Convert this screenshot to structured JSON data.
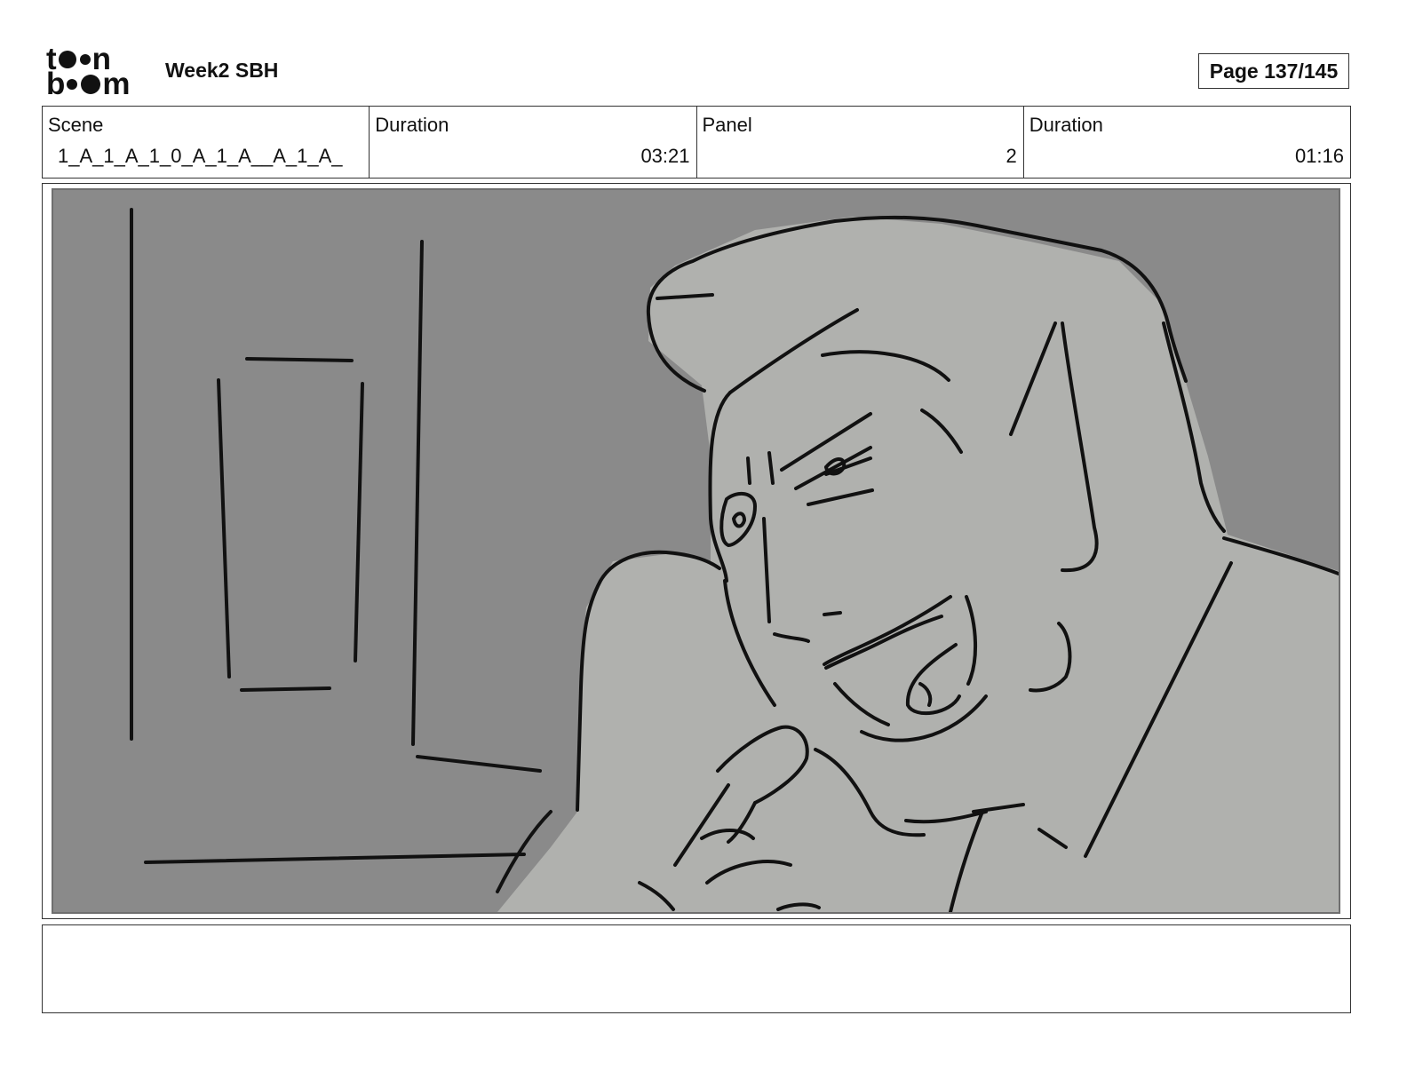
{
  "header": {
    "logo_text": "toonboom",
    "title": "Week2 SBH",
    "page_label": "Page 137/145"
  },
  "info": {
    "scene_label": "Scene",
    "scene_value": "1_A_1_A_1_0_A_1_A__A_1_A_",
    "scene_duration_label": "Duration",
    "scene_duration_value": "03:21",
    "panel_label": "Panel",
    "panel_value": "2",
    "panel_duration_label": "Duration",
    "panel_duration_value": "01:16"
  },
  "panel": {
    "background_color": "#8a8a8a",
    "figure_color": "#b0b1ae",
    "line_color": "#111111"
  },
  "notes": {
    "text": ""
  }
}
